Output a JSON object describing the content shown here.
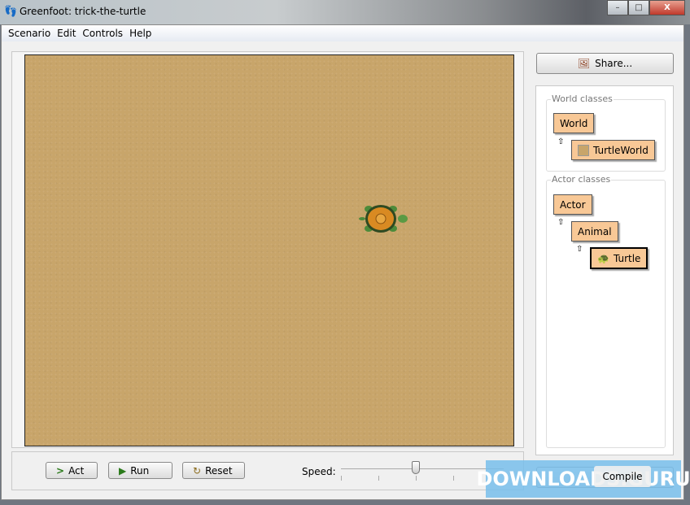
{
  "window": {
    "title": "Greenfoot: trick-the-turtle",
    "minimize": "–",
    "maximize": "□",
    "close": "X"
  },
  "menu": [
    "Scenario",
    "Edit",
    "Controls",
    "Help"
  ],
  "controls": {
    "act": "Act",
    "run": "Run",
    "reset": "Reset",
    "speed_label": "Speed:",
    "speed_percent": 50
  },
  "share": "Share...",
  "classes": {
    "world_title": "World classes",
    "world": "World",
    "turtleworld": "TurtleWorld",
    "actor_title": "Actor classes",
    "actor": "Actor",
    "animal": "Animal",
    "turtle": "Turtle"
  },
  "compile": "Compile",
  "watermark": "DOWNLOADS.GURU"
}
